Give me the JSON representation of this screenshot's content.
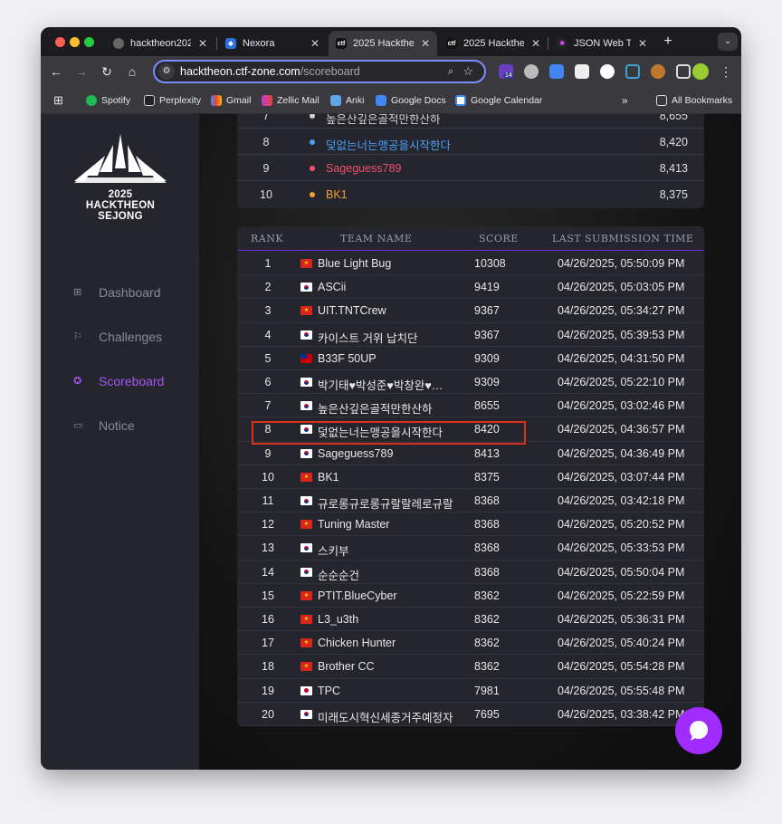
{
  "browser": {
    "tabs": [
      {
        "title": "hacktheоn202",
        "icon": "globe-icon"
      },
      {
        "title": "Nexora",
        "icon": "nexora-icon"
      },
      {
        "title": "2025 Hackthe",
        "icon": "ctf-icon"
      },
      {
        "title": "2025 Hackthe",
        "icon": "ctf-icon"
      },
      {
        "title": "JSON Web To",
        "icon": "jwt-icon"
      }
    ],
    "url_host": "hacktheon.ctf-zone.com",
    "url_path": "/scoreboard",
    "extension_badge": "14",
    "bookmarks": [
      {
        "label": "Spotify",
        "color": "#1db954"
      },
      {
        "label": "Perplexity",
        "color": "#20808d"
      },
      {
        "label": "Gmail",
        "color": "#ea4335"
      },
      {
        "label": "Zellic Mail",
        "color": "#c03bd6"
      },
      {
        "label": "Anki",
        "color": "#5ea4e8"
      },
      {
        "label": "Google Docs",
        "color": "#4285f4"
      },
      {
        "label": "Google Calendar",
        "color": "#4285f4"
      }
    ],
    "all_bookmarks": "All Bookmarks"
  },
  "logo": {
    "year": "2025",
    "name": "HACKTHEON",
    "city": "SEJONG"
  },
  "sidebar": [
    {
      "label": "Dashboard",
      "icon": "dashboard-icon",
      "active": false
    },
    {
      "label": "Challenges",
      "icon": "flag-icon",
      "active": false
    },
    {
      "label": "Scoreboard",
      "icon": "star-badge-icon",
      "active": true
    },
    {
      "label": "Notice",
      "icon": "chat-icon",
      "active": false
    }
  ],
  "top_list": [
    {
      "rank": "7",
      "name": "높은산깊은골적만한산하",
      "score": "8,655",
      "color": "#cfcfcf"
    },
    {
      "rank": "8",
      "name": "덫없는너는맹공을시작한다",
      "score": "8,420",
      "color": "#4a9ff5"
    },
    {
      "rank": "9",
      "name": "Sageguess789",
      "score": "8,413",
      "color": "#f0506e"
    },
    {
      "rank": "10",
      "name": "BK1",
      "score": "8,375",
      "color": "#f0a030"
    }
  ],
  "table": {
    "headers": {
      "rank": "RANK",
      "team": "TEAM NAME",
      "score": "SCORE",
      "time": "LAST SUBMISSION TIME"
    },
    "rows": [
      {
        "rank": "1",
        "flag": "vn",
        "team": "Blue Light Bug",
        "score": "10308",
        "time": "04/26/2025, 05:50:09 PM"
      },
      {
        "rank": "2",
        "flag": "kr",
        "team": "ASCii",
        "score": "9419",
        "time": "04/26/2025, 05:03:05 PM"
      },
      {
        "rank": "3",
        "flag": "vn",
        "team": "UIT.TNTCrew",
        "score": "9367",
        "time": "04/26/2025, 05:34:27 PM"
      },
      {
        "rank": "4",
        "flag": "kr",
        "team": "카이스트 거위 납치단",
        "score": "9367",
        "time": "04/26/2025, 05:39:53 PM"
      },
      {
        "rank": "5",
        "flag": "tw",
        "team": "B33F 50UP",
        "score": "9309",
        "time": "04/26/2025, 04:31:50 PM"
      },
      {
        "rank": "6",
        "flag": "kr",
        "team": "박기태♥박성준♥박창완♥…",
        "score": "9309",
        "time": "04/26/2025, 05:22:10 PM"
      },
      {
        "rank": "7",
        "flag": "kr",
        "team": "높은산깊은골적만한산하",
        "score": "8655",
        "time": "04/26/2025, 03:02:46 PM"
      },
      {
        "rank": "8",
        "flag": "kr",
        "team": "덫없는너는맹공을시작한다",
        "score": "8420",
        "time": "04/26/2025, 04:36:57 PM"
      },
      {
        "rank": "9",
        "flag": "kr",
        "team": "Sageguess789",
        "score": "8413",
        "time": "04/26/2025, 04:36:49 PM"
      },
      {
        "rank": "10",
        "flag": "vn",
        "team": "BK1",
        "score": "8375",
        "time": "04/26/2025, 03:07:44 PM"
      },
      {
        "rank": "11",
        "flag": "kr",
        "team": "규로롱규로롱규랄랄레로규랄…",
        "score": "8368",
        "time": "04/26/2025, 03:42:18 PM"
      },
      {
        "rank": "12",
        "flag": "vn",
        "team": "Tuning Master",
        "score": "8368",
        "time": "04/26/2025, 05:20:52 PM"
      },
      {
        "rank": "13",
        "flag": "kr",
        "team": "스키부",
        "score": "8368",
        "time": "04/26/2025, 05:33:53 PM"
      },
      {
        "rank": "14",
        "flag": "kr",
        "team": "순순순건",
        "score": "8368",
        "time": "04/26/2025, 05:50:04 PM"
      },
      {
        "rank": "15",
        "flag": "vn",
        "team": "PTIT.BlueCyber",
        "score": "8362",
        "time": "04/26/2025, 05:22:59 PM"
      },
      {
        "rank": "16",
        "flag": "vn",
        "team": "L3_u3th",
        "score": "8362",
        "time": "04/26/2025, 05:36:31 PM"
      },
      {
        "rank": "17",
        "flag": "vn",
        "team": "Chicken Hunter",
        "score": "8362",
        "time": "04/26/2025, 05:40:24 PM"
      },
      {
        "rank": "18",
        "flag": "vn",
        "team": "Brother CC",
        "score": "8362",
        "time": "04/26/2025, 05:54:28 PM"
      },
      {
        "rank": "19",
        "flag": "jp",
        "team": "TPC",
        "score": "7981",
        "time": "04/26/2025, 05:55:48 PM"
      },
      {
        "rank": "20",
        "flag": "kr",
        "team": "미래도시혁신세종거주예정자",
        "score": "7695",
        "time": "04/26/2025, 03:38:42 PM"
      }
    ]
  }
}
